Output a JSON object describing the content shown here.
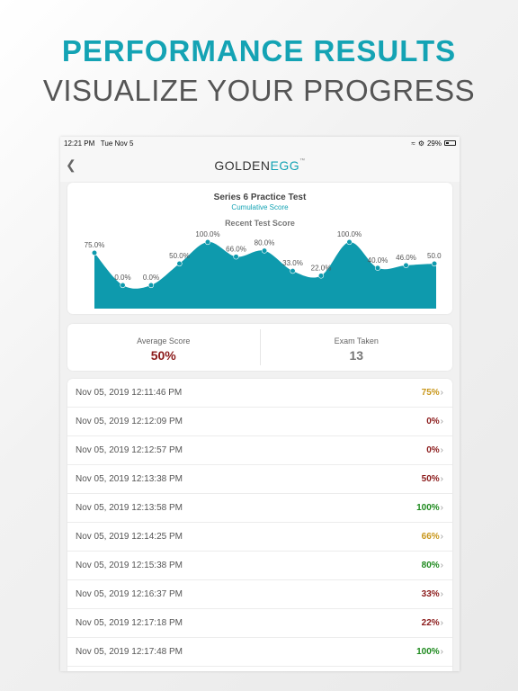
{
  "hero": {
    "title": "PERFORMANCE RESULTS",
    "subtitle": "VISUALIZE YOUR PROGRESS"
  },
  "status_bar": {
    "time": "12:21 PM",
    "date": "Tue Nov 5",
    "battery": "29%"
  },
  "nav": {
    "back_icon": "chevron-left-icon",
    "logo_part1": "GOLDEN",
    "logo_part2": "EGG",
    "logo_mark": "™"
  },
  "chart_card": {
    "title": "Series 6 Practice Test",
    "subtitle": "Cumulative Score",
    "chart_label": "Recent Test Score"
  },
  "chart_data": {
    "type": "area",
    "title": "Recent Test Score",
    "x": [
      1,
      2,
      3,
      4,
      5,
      6,
      7,
      8,
      9,
      10,
      11,
      12,
      13
    ],
    "values": [
      75,
      0,
      0,
      50,
      100,
      66,
      80,
      33,
      22,
      100,
      40,
      46,
      50
    ],
    "data_labels": [
      "75.0%",
      "0.0%",
      "0.0%",
      "50.0%",
      "100.0%",
      "66.0%",
      "80.0%",
      "33.0%",
      "22.0%",
      "100.0%",
      "40.0%",
      "46.0%",
      "50.0"
    ],
    "ylim": [
      0,
      100
    ],
    "grid": false,
    "fill_color": "#0e9aad",
    "point_color": "#0e9aad"
  },
  "stats": {
    "average_label": "Average Score",
    "average_value": "50%",
    "exams_label": "Exam Taken",
    "exams_value": "13"
  },
  "colors": {
    "accent": "#14a3b4",
    "score_high": "#1e8a1e",
    "score_mid": "#c8961a",
    "score_low": "#8b1a1a",
    "average_value": "#8b1a1a",
    "exams_value": "#777777"
  },
  "results": [
    {
      "date": "Nov 05, 2019 12:11:46 PM",
      "score": "75%",
      "color": "#c8961a"
    },
    {
      "date": "Nov 05, 2019 12:12:09 PM",
      "score": "0%",
      "color": "#8b1a1a"
    },
    {
      "date": "Nov 05, 2019 12:12:57 PM",
      "score": "0%",
      "color": "#8b1a1a"
    },
    {
      "date": "Nov 05, 2019 12:13:38 PM",
      "score": "50%",
      "color": "#8b1a1a"
    },
    {
      "date": "Nov 05, 2019 12:13:58 PM",
      "score": "100%",
      "color": "#1e8a1e"
    },
    {
      "date": "Nov 05, 2019 12:14:25 PM",
      "score": "66%",
      "color": "#c8961a"
    },
    {
      "date": "Nov 05, 2019 12:15:38 PM",
      "score": "80%",
      "color": "#1e8a1e"
    },
    {
      "date": "Nov 05, 2019 12:16:37 PM",
      "score": "33%",
      "color": "#8b1a1a"
    },
    {
      "date": "Nov 05, 2019 12:17:18 PM",
      "score": "22%",
      "color": "#8b1a1a"
    },
    {
      "date": "Nov 05, 2019 12:17:48 PM",
      "score": "100%",
      "color": "#1e8a1e"
    }
  ]
}
